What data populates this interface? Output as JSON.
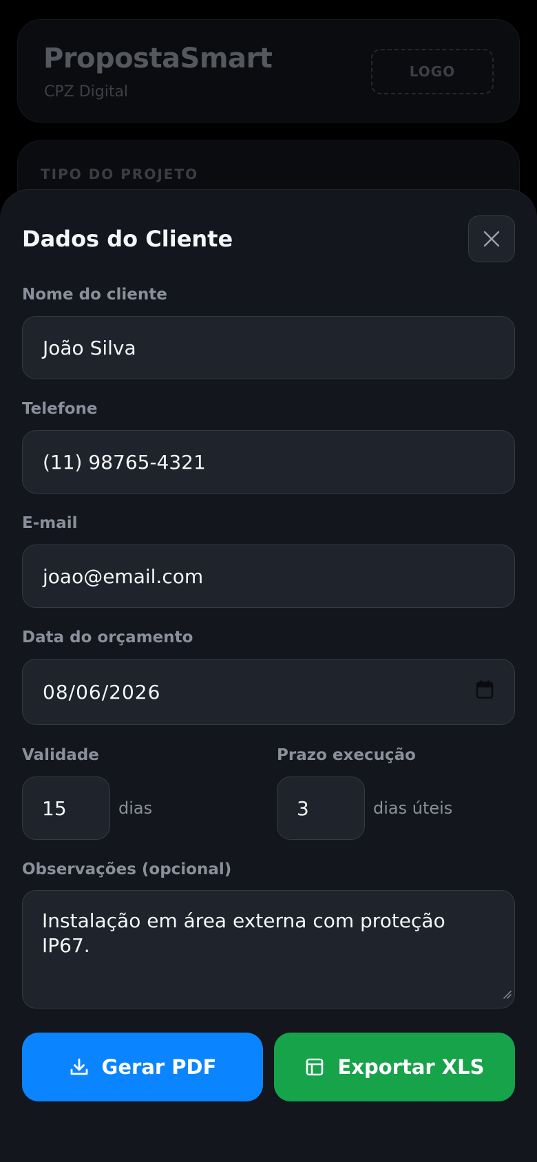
{
  "background": {
    "brand_title": "PropostaSmart",
    "brand_subtitle": "CPZ Digital",
    "logo_placeholder": "LOGO",
    "project_type_label": "TIPO DO PROJETO"
  },
  "sheet": {
    "title": "Dados do Cliente",
    "close_icon": "close-icon",
    "fields": {
      "name": {
        "label": "Nome do cliente",
        "value": "João Silva"
      },
      "phone": {
        "label": "Telefone",
        "value": "(11) 98765-4321"
      },
      "email": {
        "label": "E-mail",
        "value": "joao@email.com"
      },
      "date": {
        "label": "Data do orçamento",
        "value": "08/06/2026"
      },
      "validity": {
        "label": "Validade",
        "value": "15",
        "suffix": "dias"
      },
      "deadline": {
        "label": "Prazo execução",
        "value": "3",
        "suffix": "dias úteis"
      },
      "notes": {
        "label": "Observações (opcional)",
        "value": "Instalação em área externa com proteção IP67."
      }
    },
    "buttons": {
      "pdf": "Gerar PDF",
      "xls": "Exportar XLS"
    }
  },
  "colors": {
    "sheet_bg": "#13161c",
    "input_bg": "#1f232b",
    "pdf_button": "#0a84ff",
    "xls_button": "#16a34a"
  }
}
